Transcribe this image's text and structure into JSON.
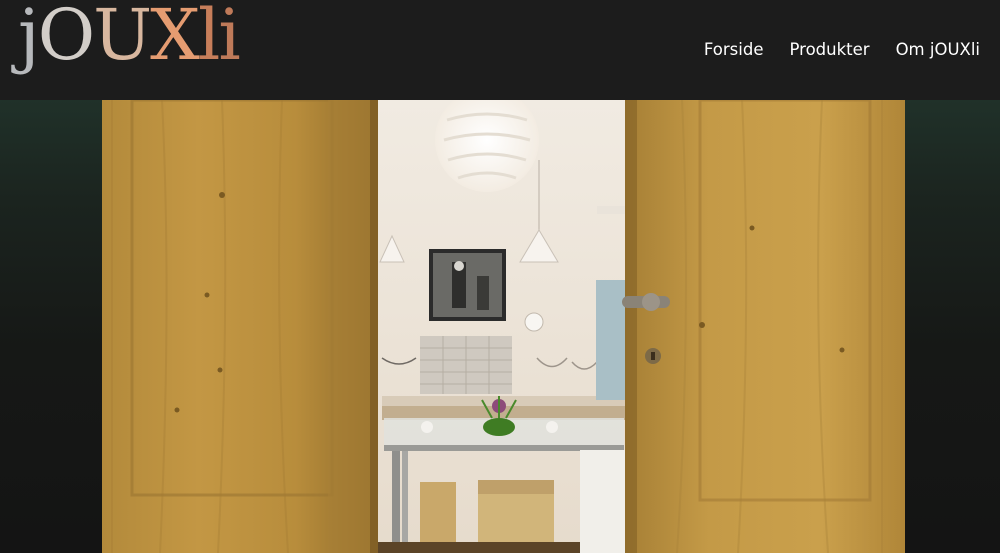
{
  "brand": {
    "logo_letters": [
      "j",
      "O",
      "U",
      "X",
      "l",
      "i"
    ],
    "logo_colors": [
      "#b7b9bc",
      "#d2cdc8",
      "#d8b79f",
      "#e59c71",
      "#c77e5a",
      "#bf7a59"
    ]
  },
  "nav": {
    "items": [
      {
        "label": "Forside"
      },
      {
        "label": "Produkter"
      },
      {
        "label": "Om jOUXli"
      }
    ]
  },
  "hero": {
    "image": "jewelry-shop-interior-through-open-wooden-doors"
  },
  "colors": {
    "header_bg": "#1c1c1c",
    "nav_text": "#ffffff",
    "side_bg_top": "#203129"
  }
}
